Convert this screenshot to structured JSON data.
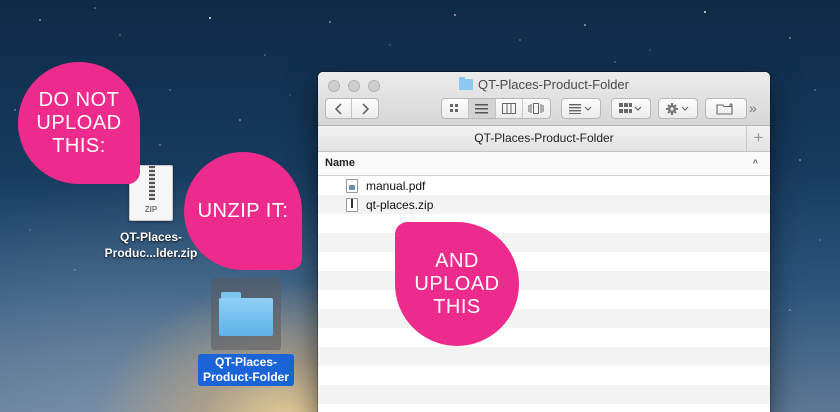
{
  "desktop": {
    "zip_file": {
      "type_tag": "ZIP",
      "label_line1": "QT-Places-",
      "label_line2": "Produc...lder.zip"
    },
    "folder": {
      "label_line1": "QT-Places-",
      "label_line2": "Product-Folder"
    }
  },
  "finder": {
    "title": "QT-Places-Product-Folder",
    "path_title": "QT-Places-Product-Folder",
    "plus_label": "+",
    "overflow_label": "»",
    "column_header": "Name",
    "sort_indicator": "^",
    "files": [
      {
        "name": "manual.pdf",
        "icon": "pdf-file-icon"
      },
      {
        "name": "qt-places.zip",
        "icon": "zip-file-icon"
      }
    ]
  },
  "callouts": {
    "do_not_upload": "DO NOT\nUPLOAD\nTHIS:",
    "unzip_it": "UNZIP IT:",
    "and_upload": "AND\nUPLOAD\nTHIS"
  },
  "colors": {
    "callout_pink": "#ed2b8c",
    "selection_blue": "#1b64d8",
    "folder_blue": "#6fbcec"
  }
}
